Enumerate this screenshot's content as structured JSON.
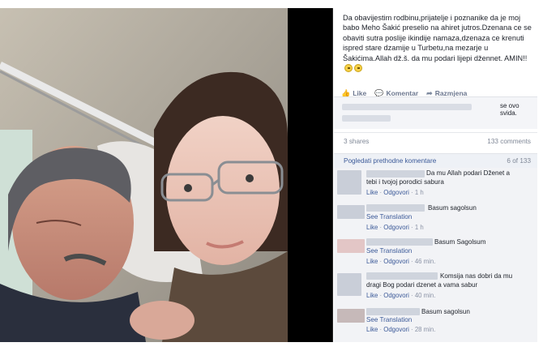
{
  "post": {
    "text": "Da obavijestim rodbinu,prijatelje i poznanike da je moj babo Meho Šakić preselio na ahiret jutros.Dzenana ce se obaviti sutra poslije ikindije namaza,dzenaza ce krenuti ispred stare dzamije u Turbetu,na mezarje u Šakićima.Allah dž.š. da mu podari lijepi džennet. AMIN!!"
  },
  "actions": {
    "like": "Like",
    "comment": "Komentar",
    "share": "Razmjena"
  },
  "likes": {
    "text": "se ovo svida."
  },
  "shares": {
    "count": "3 shares",
    "comments": "133 comments"
  },
  "previous": {
    "link": "Pogledati prethodne komentare",
    "count": "6 of 133"
  },
  "comments": [
    {
      "text1": "Da mu Allah podari Dženet a",
      "text2": "tebi i tvojoj porodici sabura",
      "like": "Like",
      "reply": "Odgovori",
      "time": "1 h",
      "see_translation": ""
    },
    {
      "text1": "Basum sagolsun",
      "text2": "",
      "like": "Like",
      "reply": "Odgovori",
      "time": "1 h",
      "see_translation": "See Translation"
    },
    {
      "text1": "Basum Sagolsum",
      "text2": "",
      "like": "Like",
      "reply": "Odgovori",
      "time": "46 min.",
      "see_translation": "See Translation"
    },
    {
      "text1": "Komsija nas dobri da mu",
      "text2": "dragi Bog podari dzenet a vama sabur",
      "like": "Like",
      "reply": "Odgovori",
      "time": "40 min.",
      "see_translation": ""
    },
    {
      "text1": "Basum sagolsun",
      "text2": "",
      "like": "Like",
      "reply": "Odgovori",
      "time": "28 min.",
      "see_translation": "See Translation"
    }
  ],
  "colors": {
    "link": "#3b5998",
    "text": "#1d2129",
    "muted": "#8b93a6"
  }
}
